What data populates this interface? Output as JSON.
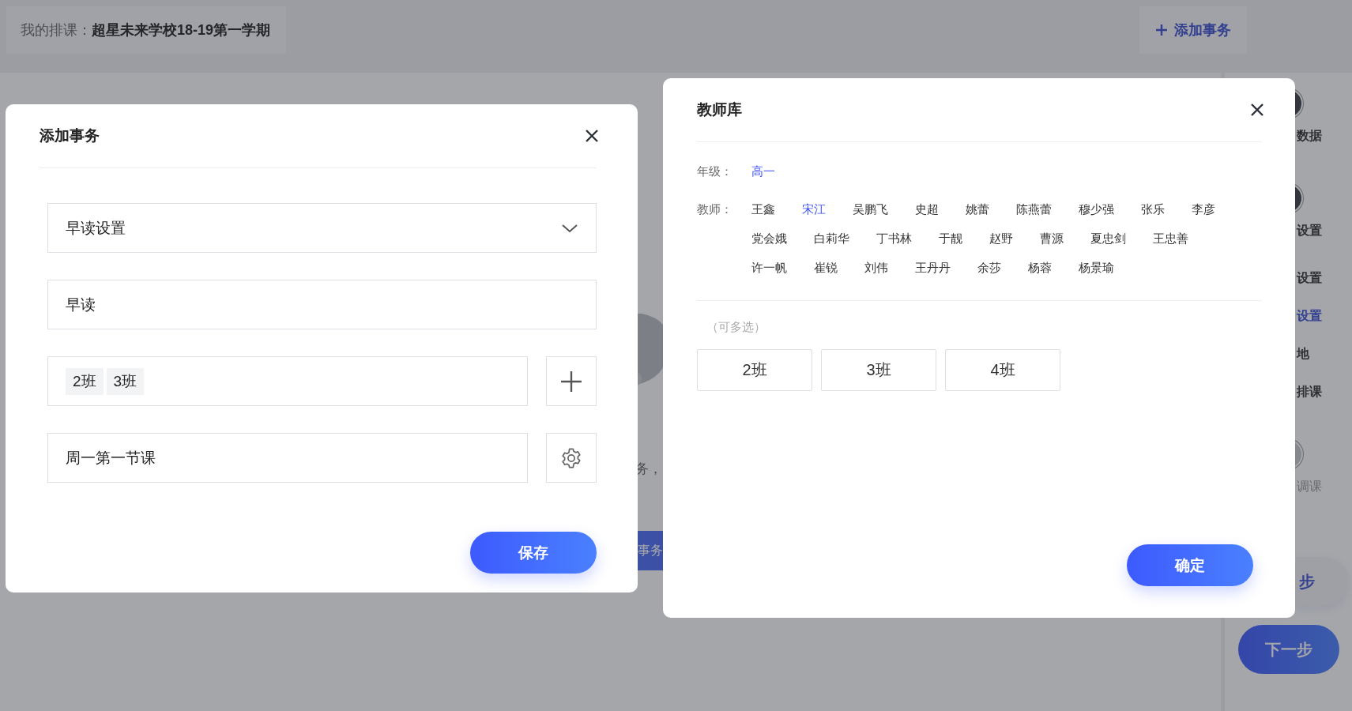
{
  "header": {
    "label": "我的排课：",
    "term": "超星未来学校18-19第一学期",
    "add_button": "添加事务"
  },
  "background": {
    "hint_text": "务，",
    "action_button": "事务"
  },
  "sidebar": {
    "items": [
      {
        "label": "数据",
        "kind": "step",
        "selected": false,
        "disabled": false
      },
      {
        "label": "设置",
        "kind": "step",
        "selected": false,
        "disabled": false
      },
      {
        "label": "设置",
        "kind": "link",
        "selected": false,
        "disabled": false
      },
      {
        "label": "设置",
        "kind": "link",
        "selected": true,
        "disabled": false
      },
      {
        "label": "地",
        "kind": "link",
        "selected": false,
        "disabled": false
      },
      {
        "label": "排课",
        "kind": "link",
        "selected": false,
        "disabled": false
      },
      {
        "label": "调课",
        "kind": "step",
        "selected": false,
        "disabled": true
      }
    ],
    "prev_button": "步",
    "next_button": "下一步"
  },
  "add_dialog": {
    "title": "添加事务",
    "type_select": "早读设置",
    "name_input": "早读",
    "classes": [
      "2班",
      "3班"
    ],
    "time_input": "周一第一节课",
    "save_button": "保存"
  },
  "teacher_dialog": {
    "title": "教师库",
    "grade_label": "年级：",
    "grades": [
      {
        "label": "高一",
        "selected": true
      }
    ],
    "teacher_label": "教师：",
    "teachers": [
      {
        "name": "王鑫",
        "selected": false
      },
      {
        "name": "宋江",
        "selected": true
      },
      {
        "name": "吴鹏飞",
        "selected": false
      },
      {
        "name": "史超",
        "selected": false
      },
      {
        "name": "姚蕾",
        "selected": false
      },
      {
        "name": "陈燕蕾",
        "selected": false
      },
      {
        "name": "穆少强",
        "selected": false
      },
      {
        "name": "张乐",
        "selected": false
      },
      {
        "name": "李彦",
        "selected": false
      },
      {
        "name": "党会娥",
        "selected": false
      },
      {
        "name": "白莉华",
        "selected": false
      },
      {
        "name": "丁书林",
        "selected": false
      },
      {
        "name": "于靓",
        "selected": false
      },
      {
        "name": "赵野",
        "selected": false
      },
      {
        "name": "曹源",
        "selected": false
      },
      {
        "name": "夏忠剑",
        "selected": false
      },
      {
        "name": "王忠善",
        "selected": false
      },
      {
        "name": "许一帆",
        "selected": false
      },
      {
        "name": "崔锐",
        "selected": false
      },
      {
        "name": "刘伟",
        "selected": false
      },
      {
        "name": "王丹丹",
        "selected": false
      },
      {
        "name": "余莎",
        "selected": false
      },
      {
        "name": "杨蓉",
        "selected": false
      },
      {
        "name": "杨景瑜",
        "selected": false
      }
    ],
    "multi_hint": "（可多选）",
    "classes": [
      {
        "label": "2班",
        "selected": false
      },
      {
        "label": "3班",
        "selected": false
      },
      {
        "label": "4班",
        "selected": false
      }
    ],
    "confirm_button": "确定"
  }
}
